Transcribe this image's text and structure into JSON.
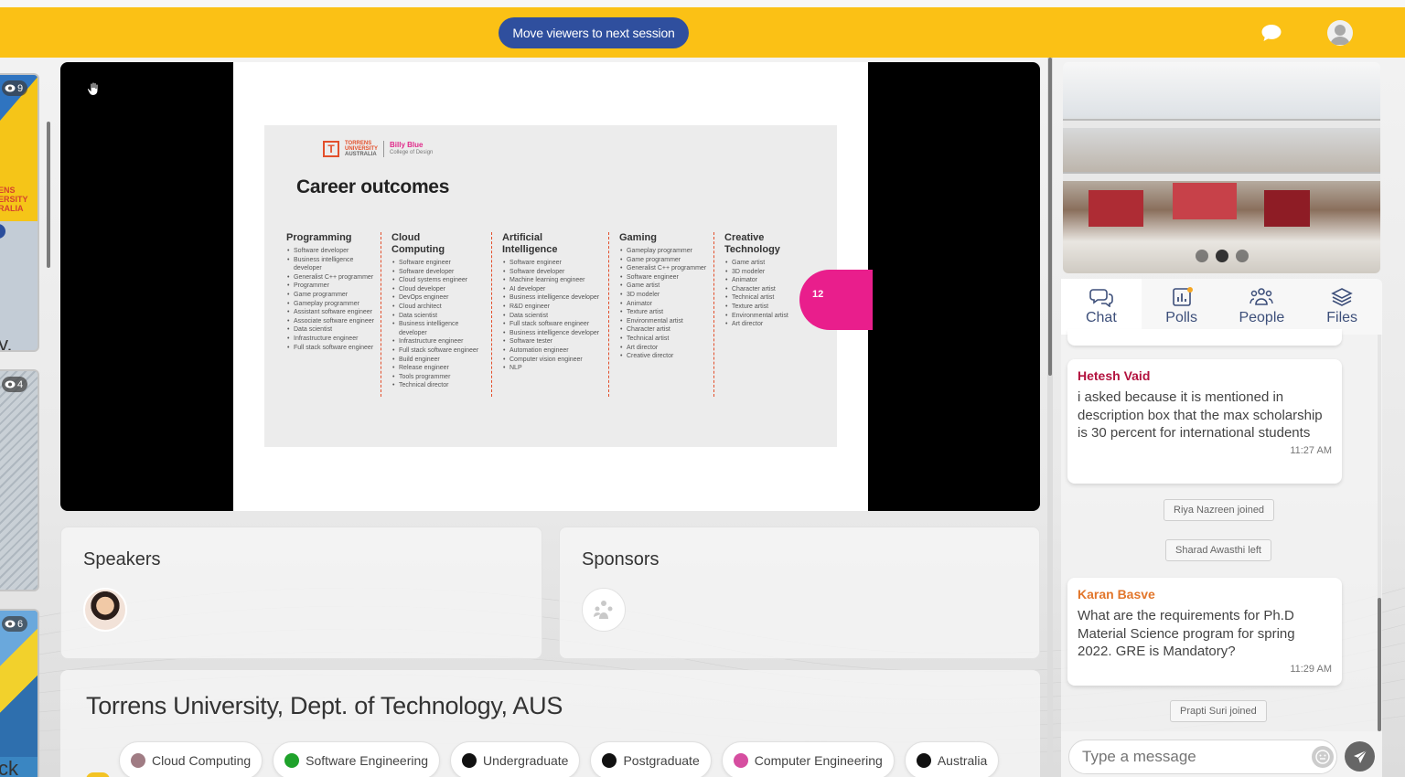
{
  "topbar": {
    "move_button_label": "Move viewers to next session",
    "accent_color": "#fbc115",
    "icons": [
      "chat-bubble-icon",
      "user-avatar-icon"
    ]
  },
  "sessions": [
    {
      "viewers": "9",
      "partial_text_1": "ENS",
      "partial_text_2": "ERSITY",
      "partial_text_3": "RALIA",
      "partial_caption": "y,"
    },
    {
      "viewers": "4"
    },
    {
      "viewers": "6",
      "partial_caption": "ck"
    }
  ],
  "slide": {
    "logo_line1": "TORRENS",
    "logo_line2": "UNIVERSITY",
    "logo_line3": "AUSTRALIA",
    "brand_name": "Billy Blue",
    "brand_sub": "College of Design",
    "title": "Career outcomes",
    "page_number": "12",
    "columns": [
      {
        "heading": "Programming",
        "items": [
          "Software developer",
          "Business intelligence developer",
          "Generalist C++ programmer",
          "Programmer",
          "Game programmer",
          "Gameplay programmer",
          "Assistant software engineer",
          "Associate software engineer",
          "Data scientist",
          "Infrastructure engineer",
          "Full stack software engineer"
        ]
      },
      {
        "heading": "Cloud Computing",
        "items": [
          "Software engineer",
          "Software developer",
          "Cloud systems engineer",
          "Cloud developer",
          "DevOps engineer",
          "Cloud architect",
          "Data scientist",
          "Business intelligence developer",
          "Infrastructure engineer",
          "Full stack software engineer",
          "Build engineer",
          "Release engineer",
          "Tools programmer",
          "Technical director"
        ]
      },
      {
        "heading": "Artificial Intelligence",
        "items": [
          "Software engineer",
          "Software developer",
          "Machine learning engineer",
          "AI developer",
          "Business intelligence developer",
          "R&D engineer",
          "Data scientist",
          "Full stack software engineer",
          "Business intelligence developer",
          "Software tester",
          "Automation engineer",
          "Computer vision engineer",
          "NLP"
        ]
      },
      {
        "heading": "Gaming",
        "items": [
          "Gameplay programmer",
          "Game programmer",
          "Generalist C++ programmer",
          "Software engineer",
          "Game artist",
          "3D modeler",
          "Animator",
          "Texture artist",
          "Environmental artist",
          "Character artist",
          "Technical artist",
          "Art director",
          "Creative director"
        ]
      },
      {
        "heading": "Creative Technology",
        "items": [
          "Game artist",
          "3D modeler",
          "Animator",
          "Character artist",
          "Technical artist",
          "Texture artist",
          "Environmental artist",
          "Art director"
        ]
      }
    ]
  },
  "speakers": {
    "title": "Speakers"
  },
  "sponsors": {
    "title": "Sponsors"
  },
  "event": {
    "title": "Torrens University, Dept. of Technology, AUS",
    "tags": [
      {
        "label": "Cloud Computing",
        "color": "#a07c84"
      },
      {
        "label": "Software Engineering",
        "color": "#1fa22b"
      },
      {
        "label": "Undergraduate",
        "color": "#111111"
      },
      {
        "label": "Postgraduate",
        "color": "#111111"
      },
      {
        "label": "Computer Engineering",
        "color": "#d64ea0"
      },
      {
        "label": "Australia",
        "color": "#111111"
      }
    ]
  },
  "sidebar": {
    "tabs": [
      {
        "label": "Chat",
        "icon": "chat-icon",
        "active": true
      },
      {
        "label": "Polls",
        "icon": "polls-icon",
        "active": false
      },
      {
        "label": "People",
        "icon": "people-icon",
        "active": false
      },
      {
        "label": "Files",
        "icon": "files-icon",
        "active": false
      }
    ],
    "messages": [
      {
        "name": "Hetesh Vaid",
        "name_color": "#b3133f",
        "text": "i asked because it is mentioned in description box that the max scholarship is 30 percent for international students",
        "time": "11:27 AM"
      },
      {
        "name": "Karan Basve",
        "name_color": "#e2762b",
        "text": "What are the requirements for Ph.D Material Science program for spring 2022. GRE is Mandatory?",
        "time": "11:29 AM"
      }
    ],
    "system_messages": [
      "Riya Nazreen joined",
      "Sharad Awasthi left",
      "Prapti Suri joined"
    ],
    "input_placeholder": "Type a message"
  }
}
